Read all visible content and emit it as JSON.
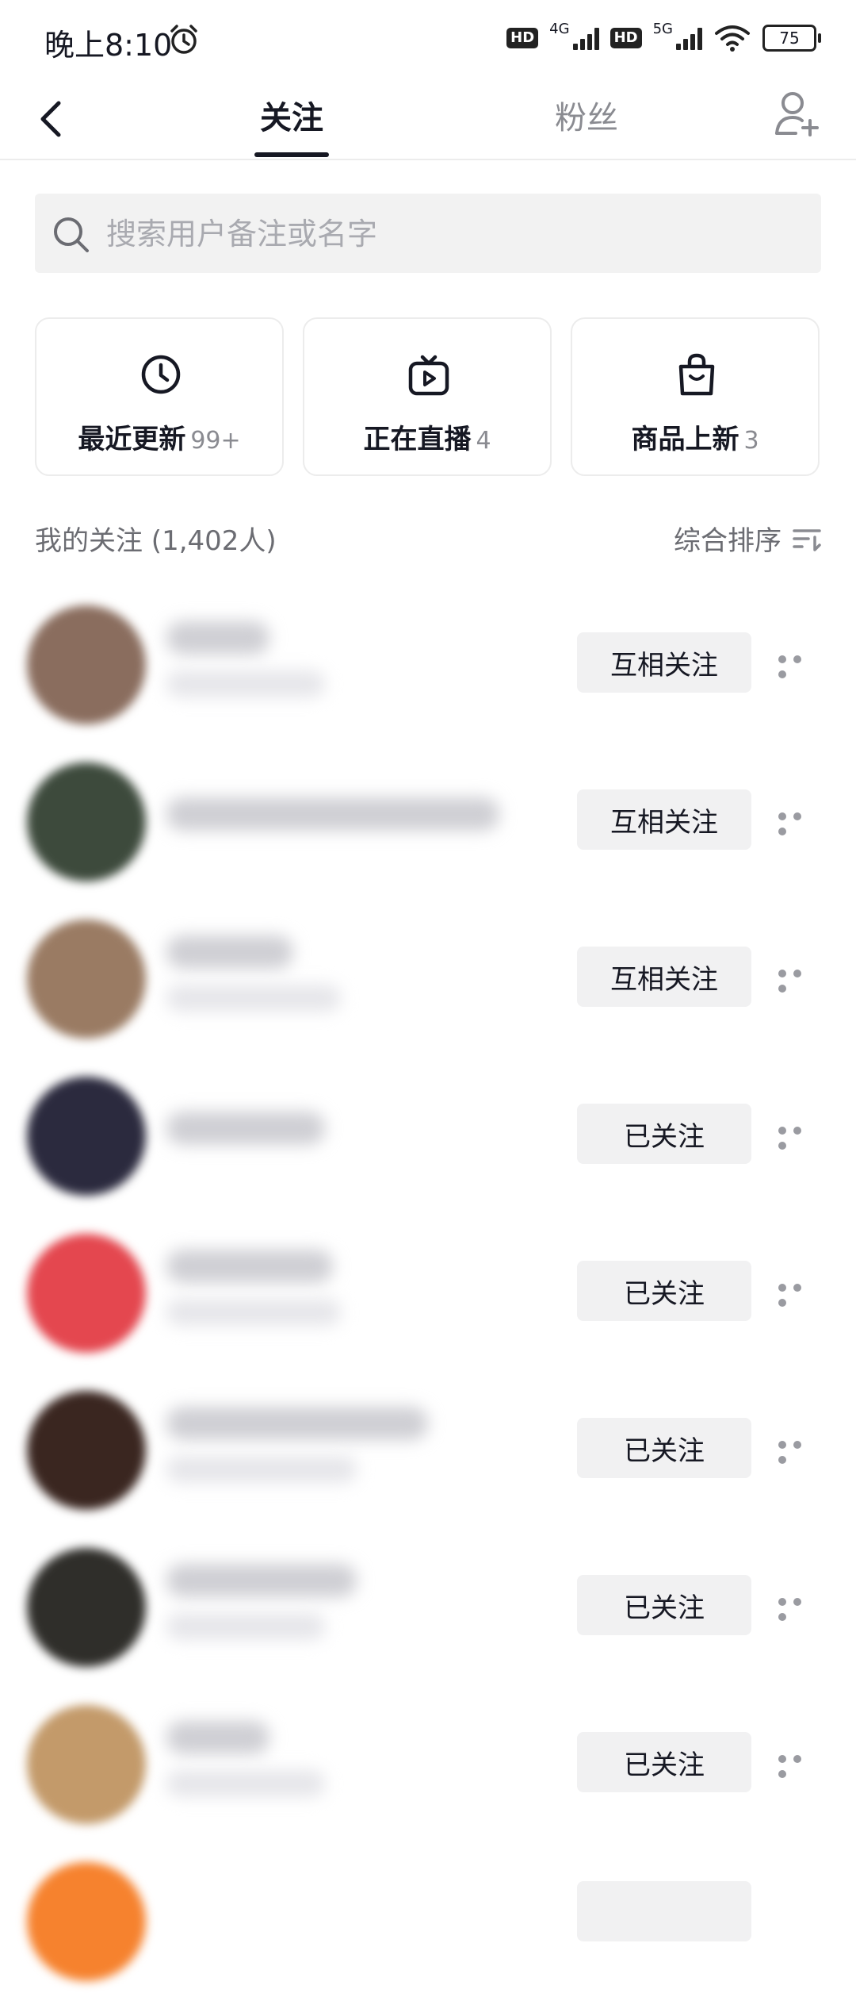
{
  "status_bar": {
    "time": "晚上8:10",
    "network_1": "4G",
    "network_2": "5G",
    "hd": "HD",
    "battery": "75"
  },
  "header": {
    "tabs": [
      {
        "label": "关注",
        "active": true
      },
      {
        "label": "粉丝",
        "active": false
      }
    ]
  },
  "search": {
    "placeholder": "搜索用户备注或名字"
  },
  "quick_cards": [
    {
      "label": "最近更新",
      "count": "99+",
      "icon": "clock-icon"
    },
    {
      "label": "正在直播",
      "count": "4",
      "icon": "tv-live-icon"
    },
    {
      "label": "商品上新",
      "count": "3",
      "icon": "shopping-bag-icon"
    }
  ],
  "section": {
    "title": "我的关注 (1,402人)",
    "sort_label": "综合排序"
  },
  "list": [
    {
      "button": "互相关注",
      "avatar_color": "#8a6d5e"
    },
    {
      "button": "互相关注",
      "avatar_color": "#3d4a3c"
    },
    {
      "button": "互相关注",
      "avatar_color": "#9a7b63"
    },
    {
      "button": "已关注",
      "avatar_color": "#2b2a3e"
    },
    {
      "button": "已关注",
      "avatar_color": "#e4474f"
    },
    {
      "button": "已关注",
      "avatar_color": "#3a2620"
    },
    {
      "button": "已关注",
      "avatar_color": "#2f2e2a"
    },
    {
      "button": "已关注",
      "avatar_color": "#c39a6a"
    }
  ],
  "colors": {
    "primary_text": "#161823",
    "secondary_text": "#8a8b91",
    "button_bg": "#f1f1f2"
  }
}
